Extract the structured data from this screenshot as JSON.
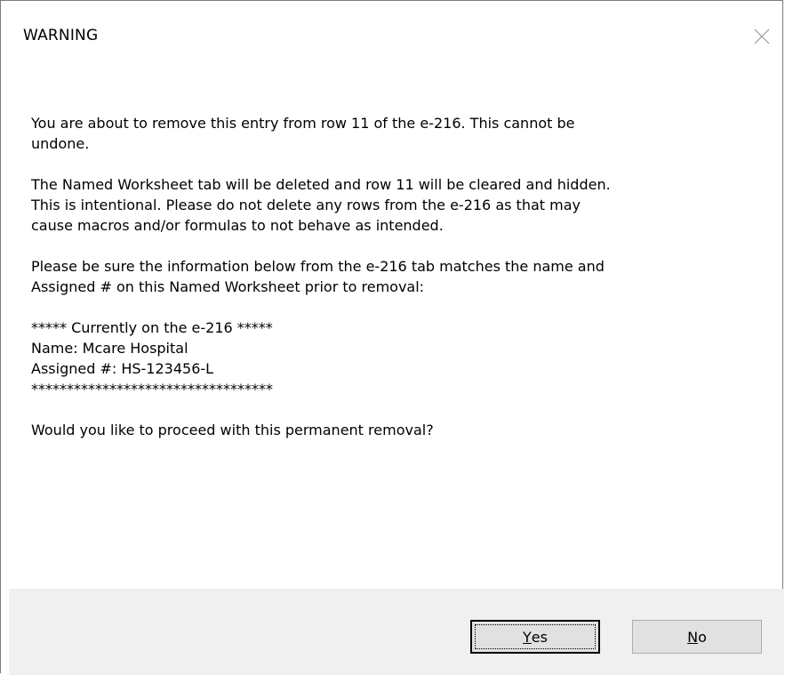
{
  "dialog": {
    "title": "WARNING",
    "close_icon": "close-icon",
    "paragraphs": [
      [
        "You are about to remove this entry from row 11 of the e-216. This cannot be",
        "undone."
      ],
      [
        "The Named Worksheet tab will be deleted and row 11 will be cleared and hidden.",
        "This is intentional. Please do not delete any rows from the e-216 as that may",
        "cause macros and/or formulas to not behave as intended."
      ],
      [
        "Please be sure the information below from the e-216 tab matches the name and",
        "Assigned # on this Named Worksheet prior to removal:"
      ],
      [
        "***** Currently on the e-216 *****",
        "Name: Mcare Hospital",
        "Assigned #: HS-123456-L",
        "**********************************"
      ],
      [
        "Would you like to proceed with this permanent removal?"
      ]
    ]
  },
  "buttons": {
    "yes": {
      "mnemonic": "Y",
      "rest": "es"
    },
    "no": {
      "mnemonic": "N",
      "rest": "o"
    }
  },
  "colors": {
    "footer_background": "#f0f0f0",
    "button_background": "#e1e1e1",
    "border": "#7a7a7a"
  }
}
